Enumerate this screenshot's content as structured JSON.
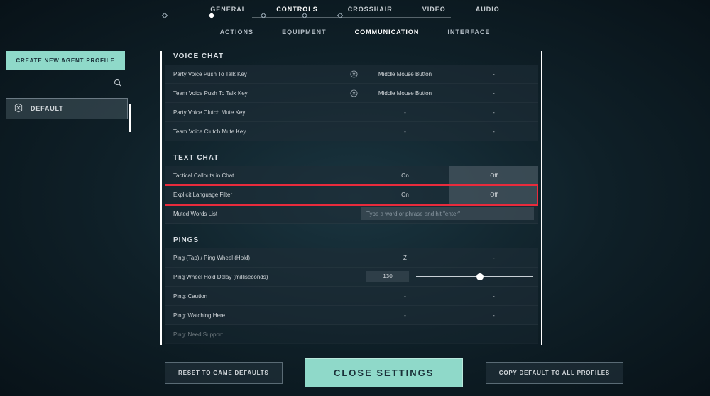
{
  "colors": {
    "accent": "#8fd9c9",
    "highlight": "#e92b3c"
  },
  "topNav": {
    "items": [
      "GENERAL",
      "CONTROLS",
      "CROSSHAIR",
      "VIDEO",
      "AUDIO"
    ],
    "activeIndex": 1
  },
  "subNav": {
    "items": [
      "ACTIONS",
      "EQUIPMENT",
      "COMMUNICATION",
      "INTERFACE"
    ],
    "activeIndex": 2
  },
  "sidebar": {
    "createButton": "CREATE NEW AGENT PROFILE",
    "profiles": [
      {
        "label": "DEFAULT"
      }
    ]
  },
  "sections": {
    "voiceChat": {
      "header": "VOICE CHAT",
      "rows": [
        {
          "label": "Party Voice Push To Talk Key",
          "clear": true,
          "primary": "Middle Mouse Button",
          "secondary": "-"
        },
        {
          "label": "Team Voice Push To Talk Key",
          "clear": true,
          "primary": "Middle Mouse Button",
          "secondary": "-"
        },
        {
          "label": "Party Voice Clutch Mute Key",
          "clear": false,
          "primary": "-",
          "secondary": "-"
        },
        {
          "label": "Team Voice Clutch Mute Key",
          "clear": false,
          "primary": "-",
          "secondary": "-"
        }
      ]
    },
    "textChat": {
      "header": "TEXT CHAT",
      "rows": [
        {
          "label": "Tactical Callouts in Chat",
          "on": "On",
          "off": "Off",
          "value": "On"
        },
        {
          "label": "Explicit Language Filter",
          "on": "On",
          "off": "Off",
          "value": "On",
          "highlight": true
        },
        {
          "label": "Muted Words List",
          "placeholder": "Type a word or phrase and hit \"enter\""
        }
      ]
    },
    "pings": {
      "header": "PINGS",
      "rows": [
        {
          "label": "Ping (Tap) / Ping Wheel (Hold)",
          "primary": "Z",
          "secondary": "-"
        },
        {
          "label": "Ping Wheel Hold Delay (milliseconds)",
          "value": "130",
          "sliderPos": 52
        },
        {
          "label": "Ping: Caution",
          "primary": "-",
          "secondary": "-"
        },
        {
          "label": "Ping: Watching Here",
          "primary": "-",
          "secondary": "-"
        },
        {
          "label": "Ping: Need Support",
          "primary": "-",
          "secondary": "-"
        }
      ]
    }
  },
  "bottom": {
    "reset": "RESET TO GAME DEFAULTS",
    "close": "CLOSE SETTINGS",
    "copy": "COPY DEFAULT TO ALL PROFILES"
  }
}
